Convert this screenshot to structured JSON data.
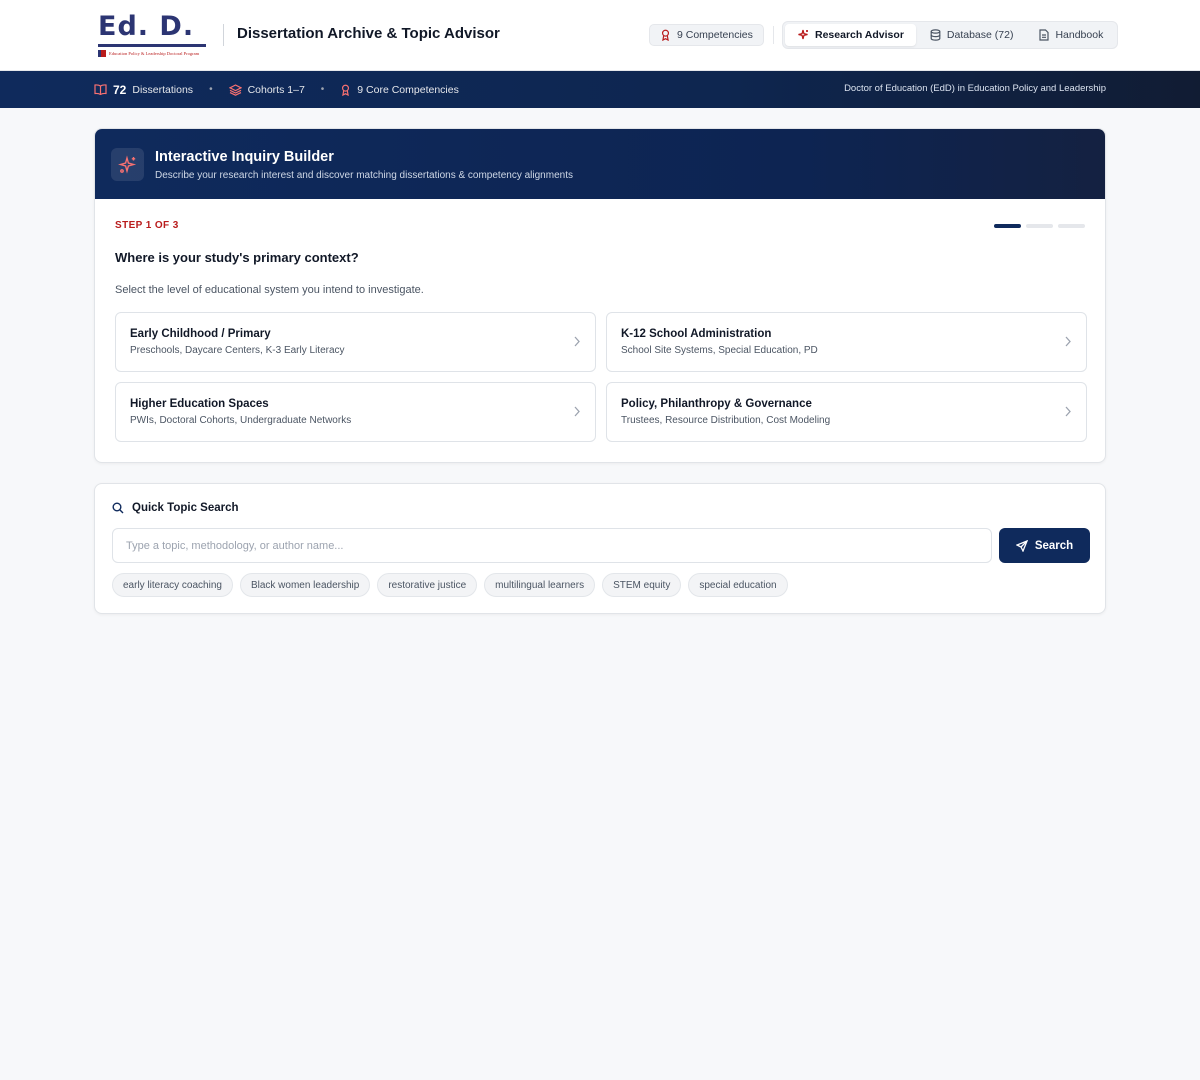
{
  "header": {
    "logo_text": "Ed. D.",
    "logo_subtitle": "Education Policy & Leadership Doctoral Program",
    "app_title": "Dissertation Archive & Topic Advisor",
    "competencies_pill": "9 Competencies",
    "nav": {
      "research_advisor": "Research Advisor",
      "database": "Database (72)",
      "handbook": "Handbook"
    }
  },
  "statbar": {
    "dissertations_count": "72",
    "dissertations_label": "Dissertations",
    "cohorts": "Cohorts 1–7",
    "competencies": "9 Core Competencies",
    "degree": "Doctor of Education (EdD) in Education Policy and Leadership"
  },
  "inquiry": {
    "title": "Interactive Inquiry Builder",
    "subtitle": "Describe your research interest and discover matching dissertations & competency alignments",
    "step_label": "STEP 1 OF 3",
    "progress": {
      "current": 1,
      "total": 3
    },
    "question": "Where is your study's primary context?",
    "question_sub": "Select the level of educational system you intend to investigate.",
    "options": [
      {
        "title": "Early Childhood / Primary",
        "subtitle": "Preschools, Daycare Centers, K-3 Early Literacy"
      },
      {
        "title": "K-12 School Administration",
        "subtitle": "School Site Systems, Special Education, PD"
      },
      {
        "title": "Higher Education Spaces",
        "subtitle": "PWIs, Doctoral Cohorts, Undergraduate Networks"
      },
      {
        "title": "Policy, Philanthropy & Governance",
        "subtitle": "Trustees, Resource Distribution, Cost Modeling"
      }
    ]
  },
  "quick_search": {
    "title": "Quick Topic Search",
    "placeholder": "Type a topic, methodology, or author name...",
    "value": "",
    "button": "Search",
    "chips": [
      "early literacy coaching",
      "Black women leadership",
      "restorative justice",
      "multilingual learners",
      "STEM equity",
      "special education"
    ]
  },
  "colors": {
    "navy": "#0f2a5c",
    "accent_red": "#b91c1c",
    "logo_navy": "#2c3573"
  }
}
